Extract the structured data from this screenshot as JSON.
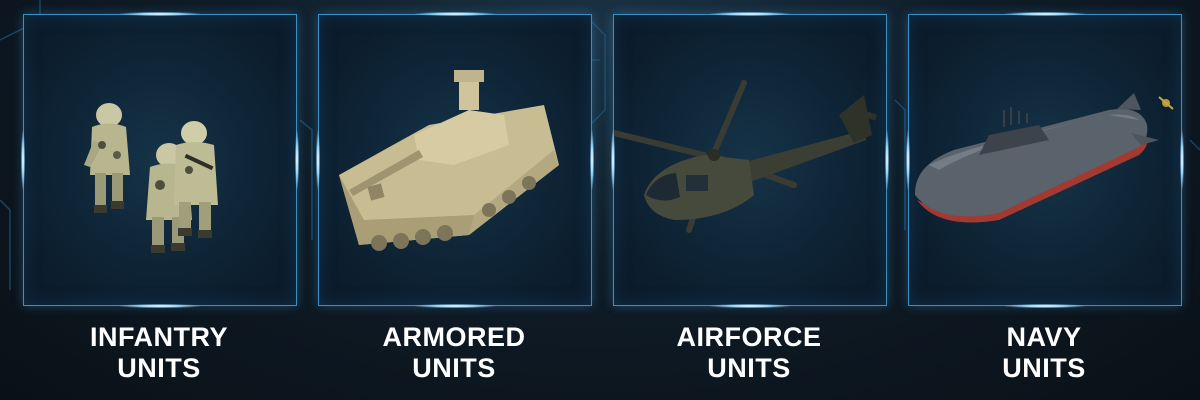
{
  "units": [
    {
      "line1": "INFANTRY",
      "line2": "UNITS"
    },
    {
      "line1": "ARMORED",
      "line2": "UNITS"
    },
    {
      "line1": "AIRFORCE",
      "line2": "UNITS"
    },
    {
      "line1": "NAVY",
      "line2": "UNITS"
    }
  ],
  "colors": {
    "frame": "#3a8fc4",
    "glow": "#9ad8ff",
    "label": "#ffffff",
    "background": "#0f1c27"
  }
}
